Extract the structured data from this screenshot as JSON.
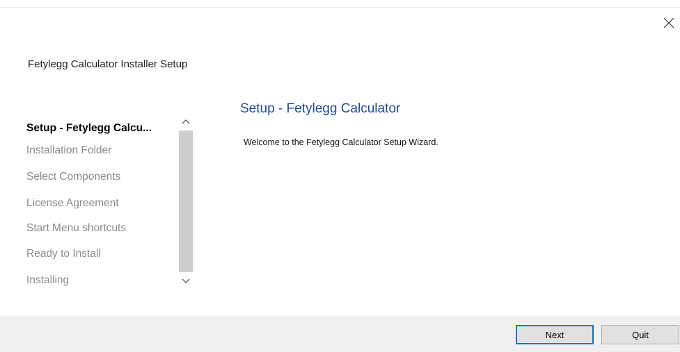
{
  "window": {
    "title": "Fetylegg Calculator Installer Setup"
  },
  "steps": [
    {
      "label": "Setup - Fetylegg Calcu...",
      "active": true
    },
    {
      "label": "Installation Folder",
      "active": false
    },
    {
      "label": "Select Components",
      "active": false
    },
    {
      "label": "License Agreement",
      "active": false
    },
    {
      "label": "Start Menu shortcuts",
      "active": false
    },
    {
      "label": "Ready to Install",
      "active": false
    },
    {
      "label": "Installing",
      "active": false
    }
  ],
  "page": {
    "heading": "Setup - Fetylegg Calculator",
    "welcome": "Welcome to the Fetylegg Calculator Setup Wizard."
  },
  "buttons": {
    "next_label": "Next",
    "quit_label": "Quit"
  },
  "icons": {
    "close": "close-icon",
    "scroll_up": "chevron-up-icon",
    "scroll_down": "chevron-down-icon"
  },
  "colors": {
    "heading": "#1f4a9a",
    "default_button_border": "#0078d7",
    "inactive_step": "#8a8a8a"
  }
}
